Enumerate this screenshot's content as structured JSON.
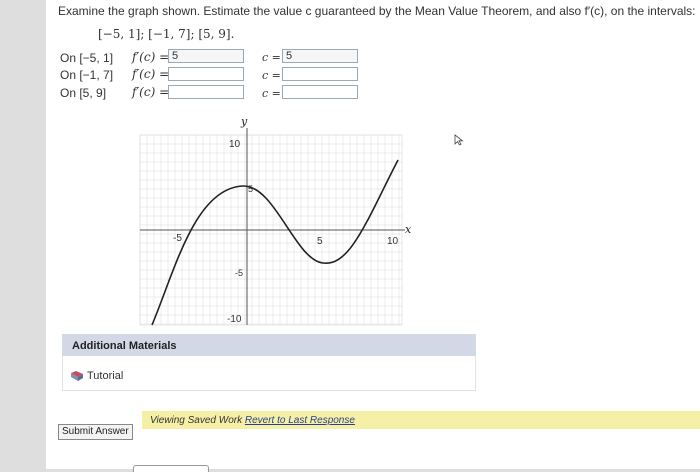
{
  "prompt": {
    "text": "Examine the graph shown. Estimate the value c guaranteed by the Mean Value Theorem, and also f′(c), on the intervals:",
    "intervals": "[−5, 1]; [−1, 7]; [5, 9]."
  },
  "rows": [
    {
      "interval": "On [−5, 1]",
      "fprime_label": "f′(c) =",
      "fprime_value": "5",
      "c_label": "c =",
      "c_value": "5"
    },
    {
      "interval": "On [−1, 7]",
      "fprime_label": "f′(c) =",
      "fprime_value": "",
      "c_label": "c =",
      "c_value": ""
    },
    {
      "interval": "On [5, 9]",
      "fprime_label": "f′(c) =",
      "fprime_value": "",
      "c_label": "c =",
      "c_value": ""
    }
  ],
  "graph": {
    "x_label": "x",
    "y_label": "y",
    "ticks": {
      "x_neg": "-5",
      "x_pos5": "5",
      "x_pos10": "10",
      "y_pos10": "10",
      "y_pos5": "5",
      "y_neg5": "-5",
      "y_neg10": "-10"
    }
  },
  "additional": {
    "title": "Additional Materials",
    "tutorial": "Tutorial"
  },
  "footer": {
    "submit": "Submit Answer",
    "saved_prefix": "Viewing Saved Work",
    "revert_link": "Revert to Last Response"
  }
}
